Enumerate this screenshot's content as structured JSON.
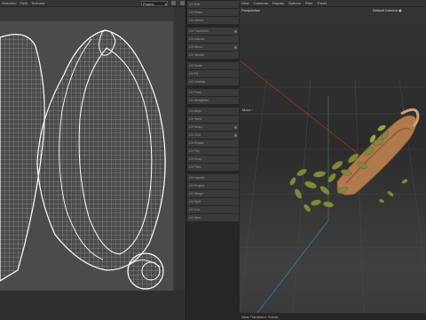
{
  "uv_editor": {
    "menu": [
      "Selection",
      "Field",
      "Textures"
    ],
    "project_select": "Project"
  },
  "attribute_panel": {
    "rows": [
      "UV Edit",
      "UV Relax",
      "UV Select",
      "UV Transform",
      "UV Islands",
      "UV Mirror",
      "UV Stretch",
      "UV Scale",
      "UV Fit",
      "UV Unwrap",
      "UV Pack",
      "UV Straighten",
      "UV Align",
      "UV Weld",
      "UV Seam",
      "UV Grid",
      "UV Rotate",
      "UV Flip",
      "UV Snap",
      "UV Tiles",
      "UV Layout",
      "UV Project",
      "UV Merge",
      "UV Split",
      "UV Cut",
      "UV Sew",
      "UV Pin",
      "UV Unpin",
      "UV Normalize",
      "UV Orient"
    ]
  },
  "viewport": {
    "menu": [
      "View",
      "Cameras",
      "Display",
      "Options",
      "Filter",
      "Panel"
    ],
    "view_name": "Perspective",
    "camera_name": "Default Camera",
    "camera_icon": "camera-icon",
    "small_window": "Move",
    "footer": "View Transform: Scene"
  },
  "colors": {
    "uv_background": "#4b4b4b",
    "wireframe": "#ffffff",
    "scoop_wood": "#b07a4c",
    "seed_green": "#7d8a3a",
    "axis_red": "#c0392b",
    "axis_green": "#2ecc71",
    "axis_blue": "#3498db"
  }
}
